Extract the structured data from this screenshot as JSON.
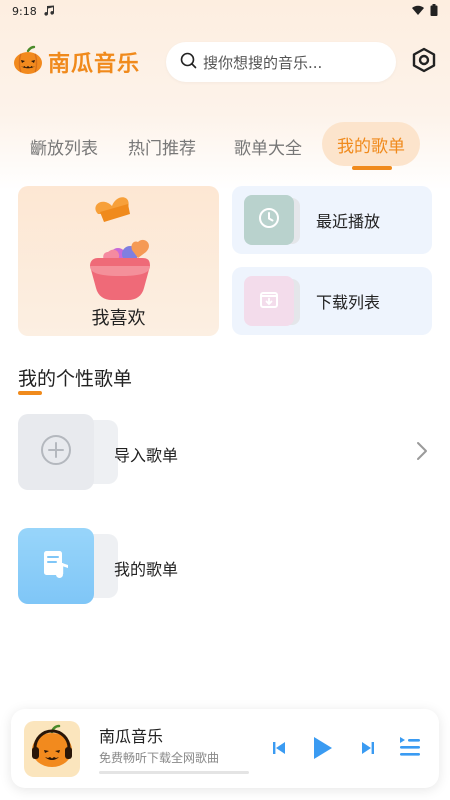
{
  "status": {
    "time": "9:18"
  },
  "app": {
    "name": "南瓜音乐"
  },
  "search": {
    "placeholder": "搜你想搜的音乐..."
  },
  "tabs": [
    {
      "label": "播放列表"
    },
    {
      "label": "热门推荐"
    },
    {
      "label": "歌单大全"
    },
    {
      "label": "我的歌单",
      "active": true
    }
  ],
  "tab_first_visible": "齭放列表",
  "cards": {
    "favorites": {
      "label": "我喜欢"
    },
    "recent": {
      "label": "最近播放"
    },
    "downloads": {
      "label": "下载列表"
    }
  },
  "section": {
    "title": "我的个性歌单"
  },
  "playlists": [
    {
      "label": "导入歌单",
      "icon": "plus-circle-icon"
    },
    {
      "label": "我的歌单",
      "icon": "music-note-icon"
    }
  ],
  "player": {
    "title": "南瓜音乐",
    "subtitle": "免费畅听下载全网歌曲",
    "progress": 0
  },
  "colors": {
    "accent": "#f08a1c",
    "tab_active_bg": "#fce4cc",
    "play_blue": "#3a9bf2",
    "side_card_bg": "#eef4fd"
  }
}
